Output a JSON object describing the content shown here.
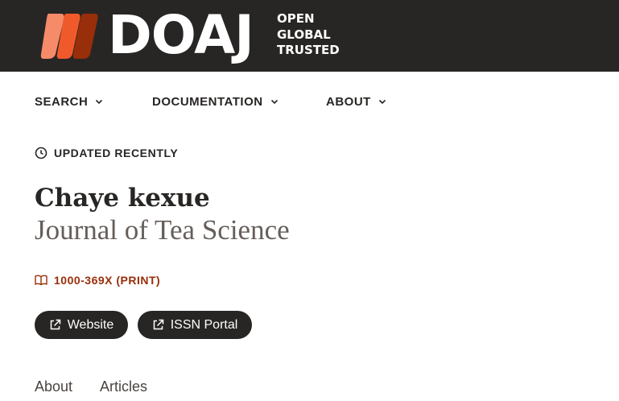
{
  "brand": {
    "name": "DOAJ",
    "tagline": [
      "OPEN",
      "GLOBAL",
      "TRUSTED"
    ],
    "colors": {
      "bar": "#282624",
      "leaf_light": "#f68b6a",
      "leaf_mid": "#f05a2b",
      "leaf_dark": "#982e0a"
    }
  },
  "nav": [
    {
      "label": "SEARCH"
    },
    {
      "label": "DOCUMENTATION"
    },
    {
      "label": "ABOUT"
    }
  ],
  "status": {
    "label": "UPDATED RECENTLY",
    "icon": "clock-icon"
  },
  "journal": {
    "title": "Chaye kexue",
    "alt_title": "Journal of Tea Science",
    "issn": "1000-369X (PRINT)",
    "issn_icon": "book-icon"
  },
  "actions": [
    {
      "label": "Website",
      "icon": "external-link-icon"
    },
    {
      "label": "ISSN Portal",
      "icon": "external-link-icon"
    }
  ],
  "tabs": [
    {
      "label": "About"
    },
    {
      "label": "Articles"
    }
  ]
}
